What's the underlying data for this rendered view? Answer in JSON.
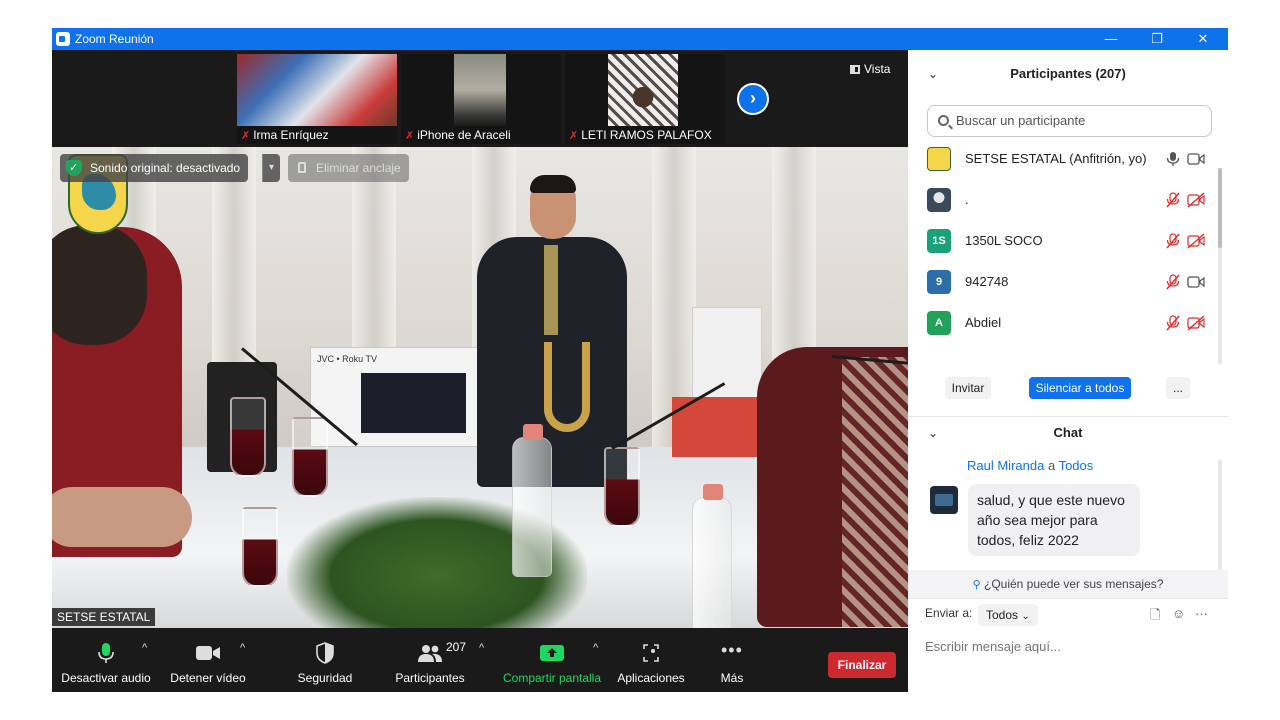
{
  "window": {
    "title": "Zoom Reunión",
    "controls": {
      "minimize": "—",
      "restore": "❐",
      "close": "✕"
    }
  },
  "thumbnails": [
    {
      "name": "Irma Enríquez",
      "muted": true
    },
    {
      "name": "iPhone de Araceli",
      "muted": true
    },
    {
      "name": "LETI RAMOS PALAFOX",
      "muted": true
    }
  ],
  "view_button": "Vista",
  "main_video": {
    "original_sound": "Sonido original: desactivado",
    "unpin": "Eliminar anclaje",
    "speaker_name": "SETSE ESTATAL"
  },
  "toolbar": {
    "mute": "Desactivar audio",
    "video": "Detener vídeo",
    "security": "Seguridad",
    "participants": "Participantes",
    "participants_count": "207",
    "share": "Compartir pantalla",
    "apps": "Aplicaciones",
    "more": "Más",
    "end": "Finalizar"
  },
  "participants_panel": {
    "title": "Participantes (207)",
    "search_placeholder": "Buscar un participante",
    "list": [
      {
        "name": "SETSE ESTATAL (Anfitrión, yo)",
        "avatar": "",
        "avatar_color": "#f5d64b",
        "mic_muted": false,
        "cam_off": false
      },
      {
        "name": ".",
        "avatar": "",
        "avatar_color": "#3a4a5a",
        "mic_muted": true,
        "cam_off": true
      },
      {
        "name": "1350L SOCO",
        "avatar": "1S",
        "avatar_color": "#1aa179",
        "mic_muted": true,
        "cam_off": true
      },
      {
        "name": "942748",
        "avatar": "9",
        "avatar_color": "#2d6ea8",
        "mic_muted": true,
        "cam_off": false
      },
      {
        "name": "Abdiel",
        "avatar": "A",
        "avatar_color": "#22a15a",
        "mic_muted": true,
        "cam_off": true
      }
    ],
    "invite": "Invitar",
    "mute_all": "Silenciar a todos",
    "more": "..."
  },
  "chat_panel": {
    "title": "Chat",
    "messages": [
      {
        "sender": "Raul Miranda",
        "to_word": "a",
        "to": "Todos",
        "text": "salud, y que este nuevo año sea mejor para todos, feliz 2022"
      }
    ],
    "who_can_see": "¿Quién puede ver sus mensajes?",
    "send_to_label": "Enviar a:",
    "send_to_value": "Todos",
    "input_placeholder": "Escribir mensaje aquí...",
    "more": "···"
  },
  "colors": {
    "zoom_blue": "#0e72ed",
    "end_red": "#cc2a2f",
    "share_green": "#1ed760",
    "mute_red": "#e02828"
  }
}
